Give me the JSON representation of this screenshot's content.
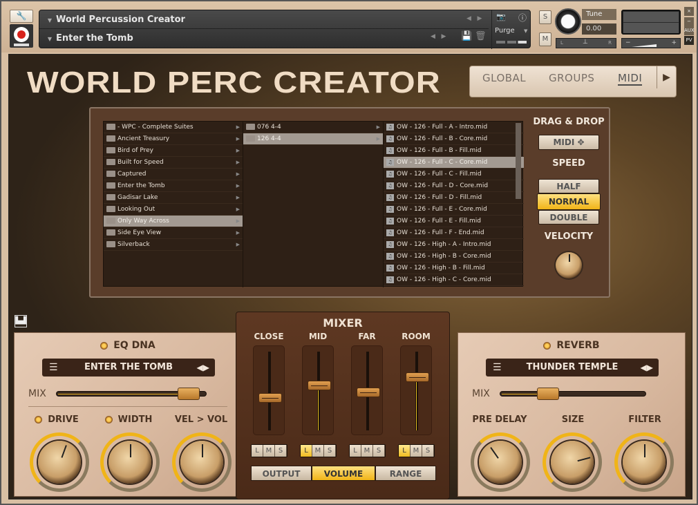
{
  "header": {
    "instrument_name": "World Percussion Creator",
    "preset_name": "Enter the Tomb",
    "purge_label": "Purge",
    "solo_label": "S",
    "mute_label": "M",
    "tune_label": "Tune",
    "tune_value": "0.00",
    "pan_left": "L",
    "pan_right": "R",
    "vol_minus": "−",
    "vol_plus": "+",
    "close_label": "×",
    "minimize_label": "−",
    "aux_label": "AUX",
    "pv_label": "PV"
  },
  "logo": "WORLD PERC CREATOR",
  "tabs": [
    {
      "label": "GLOBAL",
      "active": false
    },
    {
      "label": "GROUPS",
      "active": false
    },
    {
      "label": "MIDI",
      "active": true
    }
  ],
  "browser": {
    "folders": [
      {
        "label": "- WPC - Complete Suites",
        "selected": false
      },
      {
        "label": "Ancient Treasury",
        "selected": false
      },
      {
        "label": "Bird of Prey",
        "selected": false
      },
      {
        "label": "Built for Speed",
        "selected": false
      },
      {
        "label": "Captured",
        "selected": false
      },
      {
        "label": "Enter the Tomb",
        "selected": false
      },
      {
        "label": "Gadisar Lake",
        "selected": false
      },
      {
        "label": "Looking Out",
        "selected": false
      },
      {
        "label": "Only Way Across",
        "selected": true
      },
      {
        "label": "Side Eye View",
        "selected": false
      },
      {
        "label": "Silverback",
        "selected": false
      }
    ],
    "subfolders": [
      {
        "label": "076 4-4",
        "selected": false
      },
      {
        "label": "126 4-4",
        "selected": true
      }
    ],
    "files": [
      {
        "label": "OW - 126 - Full - A - Intro.mid",
        "selected": false
      },
      {
        "label": "OW - 126 - Full - B - Core.mid",
        "selected": false
      },
      {
        "label": "OW - 126 - Full - B - Fill.mid",
        "selected": false
      },
      {
        "label": "OW - 126 - Full - C - Core.mid",
        "selected": true
      },
      {
        "label": "OW - 126 - Full - C - Fill.mid",
        "selected": false
      },
      {
        "label": "OW - 126 - Full - D - Core.mid",
        "selected": false
      },
      {
        "label": "OW - 126 - Full - D - Fill.mid",
        "selected": false
      },
      {
        "label": "OW - 126 - Full - E - Core.mid",
        "selected": false
      },
      {
        "label": "OW - 126 - Full - E - Fill.mid",
        "selected": false
      },
      {
        "label": "OW - 126 - Full - F - End.mid",
        "selected": false
      },
      {
        "label": "OW - 126 - High - A - Intro.mid",
        "selected": false
      },
      {
        "label": "OW - 126 - High - B - Core.mid",
        "selected": false
      },
      {
        "label": "OW - 126 - High - B - Fill.mid",
        "selected": false
      },
      {
        "label": "OW - 126 - High - C - Core.mid",
        "selected": false
      }
    ]
  },
  "midi_controls": {
    "drag_drop_label": "DRAG & DROP",
    "midi_button": "MIDI",
    "speed_label": "SPEED",
    "speed_options": [
      "HALF",
      "NORMAL",
      "DOUBLE"
    ],
    "speed_selected": "NORMAL",
    "velocity_label": "VELOCITY"
  },
  "eq": {
    "title": "EQ DNA",
    "preset": "ENTER THE TOMB",
    "mix_label": "MIX",
    "mix_value": 0.95,
    "knobs": [
      {
        "label": "DRIVE",
        "lamp": true,
        "value": 0.55
      },
      {
        "label": "WIDTH",
        "lamp": true,
        "value": 0.5
      },
      {
        "label": "VEL > VOL",
        "lamp": false,
        "value": 0.5
      }
    ]
  },
  "mixer": {
    "title": "MIXER",
    "channels": [
      {
        "label": "CLOSE",
        "level": 0.4,
        "solo_state": ""
      },
      {
        "label": "MID",
        "level": 0.58,
        "solo_state": "L"
      },
      {
        "label": "FAR",
        "level": 0.48,
        "solo_state": ""
      },
      {
        "label": "ROOM",
        "level": 0.7,
        "solo_state": "L"
      }
    ],
    "lms": [
      "L",
      "M",
      "S"
    ],
    "modes": [
      "OUTPUT",
      "VOLUME",
      "RANGE"
    ],
    "mode_selected": "VOLUME"
  },
  "reverb": {
    "title": "REVERB",
    "preset": "THUNDER TEMPLE",
    "mix_label": "MIX",
    "mix_value": 0.3,
    "knobs": [
      {
        "label": "PRE DELAY",
        "value": 0.3
      },
      {
        "label": "SIZE",
        "value": 0.75
      },
      {
        "label": "FILTER",
        "value": 0.5
      }
    ]
  }
}
